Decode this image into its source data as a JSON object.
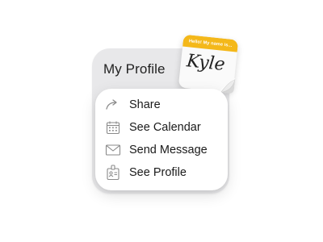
{
  "widget": {
    "title": "My Profile"
  },
  "sticker": {
    "header_text": "Hello! My name is...",
    "name": "Kyle"
  },
  "menu": {
    "items": [
      {
        "label": "Share",
        "icon": "share-arrow-icon"
      },
      {
        "label": "See Calendar",
        "icon": "calendar-icon"
      },
      {
        "label": "Send Message",
        "icon": "envelope-icon"
      },
      {
        "label": "See Profile",
        "icon": "id-badge-icon"
      }
    ]
  },
  "colors": {
    "sticker_band": "#f4b81a",
    "widget_bg": "#e8e8ea",
    "card_bg": "#ffffff",
    "text": "#1a1a1a"
  }
}
